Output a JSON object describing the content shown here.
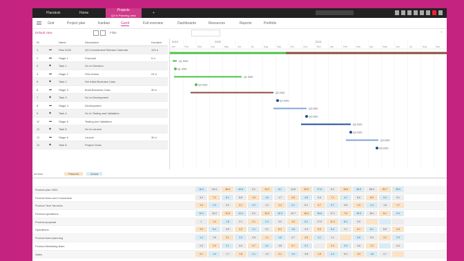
{
  "app": {
    "tabs": [
      "Plandesk",
      "Home",
      "Projects"
    ],
    "tab_subtitle": "Q3 In Planning view",
    "active_tab_index": 2,
    "add_tab_label": "+"
  },
  "ribbon": {
    "items": [
      "Grid",
      "Project plan",
      "Kanban",
      "Gantt",
      "Full overview",
      "Dashboards",
      "Resources",
      "Reports",
      "Portfolio"
    ]
  },
  "toolbar": {
    "view_label": "Default view",
    "filter_label": "Filter",
    "plus_label": "+"
  },
  "gantt": {
    "years": [
      "2019",
      "2020",
      "2021"
    ],
    "months": [
      "Jan",
      "Feb",
      "Mar",
      "Apr",
      "May",
      "Jun",
      "Jul",
      "Aug",
      "Sep",
      "Oct",
      "Nov",
      "Dec",
      "Jan",
      "Feb",
      "Mar",
      "Apr",
      "May",
      "Jun",
      "Jul",
      "Aug",
      "Sep"
    ],
    "bar_labels": [
      "Q1 2020",
      "Q1 2020",
      "Q1 2020",
      "Q2 2020",
      "Q2 2020",
      "Q2 2020",
      "Q3 2020",
      "Q3 2020",
      "Q3 2020",
      "Q3 2020",
      "Q4 2020",
      "Q4 2020"
    ],
    "colors": {
      "green": "#4cc247",
      "blue": "#1f4f95",
      "light_blue": "#7fa6d6",
      "brown": "#8a4b3e"
    }
  },
  "grid": {
    "headers": [
      "ID",
      "Name",
      "Description",
      "Duration"
    ],
    "rows": [
      {
        "id": "1",
        "name": "Plan 2020",
        "description": "Q3 Commitment Release Calendar",
        "duration": "120 d",
        "kind": "summary"
      },
      {
        "id": "2",
        "name": "Stage 1",
        "description": "Proposal",
        "duration": "9 d",
        "kind": "task"
      },
      {
        "id": "3",
        "name": "Task 1",
        "description": "Go to Direction",
        "duration": "",
        "kind": "milestone"
      },
      {
        "id": "4",
        "name": "Stage 2",
        "description": "First review",
        "duration": "24 d",
        "kind": "task"
      },
      {
        "id": "5",
        "name": "Task 2",
        "description": "Set Initial Business Case",
        "duration": "",
        "kind": "milestone"
      },
      {
        "id": "6",
        "name": "Stage 3",
        "description": "Build Business Case",
        "duration": "30 d",
        "kind": "task"
      },
      {
        "id": "7",
        "name": "Task 3",
        "description": "Go to Development",
        "duration": "",
        "kind": "milestone"
      },
      {
        "id": "8",
        "name": "Stage 4",
        "description": "Development",
        "duration": "",
        "kind": "task"
      },
      {
        "id": "9",
        "name": "Task 4",
        "description": "Go to Testing and Validation",
        "duration": "",
        "kind": "milestone"
      },
      {
        "id": "10",
        "name": "Stage 5",
        "description": "Testing and Validation",
        "duration": "",
        "kind": "task"
      },
      {
        "id": "11",
        "name": "Task 5",
        "description": "Go to Launch",
        "duration": "",
        "kind": "milestone"
      },
      {
        "id": "12",
        "name": "Stage 6",
        "description": "Launch",
        "duration": "30 d",
        "kind": "task"
      },
      {
        "id": "13",
        "name": "Task 6",
        "description": "Project Close",
        "duration": "",
        "kind": "milestone"
      }
    ]
  },
  "summary": {
    "label": "All time",
    "legend": [
      "Planned",
      "Actual"
    ]
  },
  "bottom_table": {
    "rows": [
      {
        "label": "Product plan 2020",
        "values": [
          "16.4",
          "23.4",
          "46.6",
          "44.5",
          "5.1",
          "13.2",
          "6.1",
          "14.8",
          "25.9",
          "17.6",
          "5.1",
          "15.6",
          "45.9",
          "68.3",
          "52.7",
          "35.9"
        ]
      },
      {
        "label": "Product team and Consortium",
        "values": [
          "3.4",
          "7.2",
          "8.1",
          "8.8",
          "1.6",
          "1.6",
          "1.7",
          "2.6",
          "4.5",
          "5.4",
          "7.1",
          "4.1",
          "8.6",
          "8.9",
          "9.2",
          "9.1"
        ]
      },
      {
        "label": "Product Tech Services",
        "values": [
          "1.4",
          "2.3",
          "3.4",
          "2.1",
          "2.2",
          "1.2",
          "1.4",
          "2.1",
          "6.1",
          "4.7",
          "3.7",
          "4.6",
          "1.2",
          "1.4",
          "1.6",
          "1.7"
        ]
      },
      {
        "label": "Product operations",
        "values": [
          "10.4",
          "10.2",
          "12.5",
          "12.4",
          "6.2",
          "10.0",
          "10.3",
          "12.7",
          "18.4",
          "16.6",
          "17.1",
          "7.6",
          "16.5",
          "18.1",
          "8.1",
          "9.4"
        ]
      },
      {
        "label": "Product proposal",
        "values": [
          "1",
          "1.4",
          "1.8",
          "2.1",
          "2.1",
          "2.4",
          "3.0",
          "1.9",
          "6.2",
          "17.9",
          "11.4",
          "8.4",
          "9.9",
          "",
          "",
          ""
        ]
      },
      {
        "label": "Operations",
        "values": [
          "3.9",
          "5.4",
          "4.5",
          "4.2",
          "1.1",
          "3.1",
          "6.2",
          "1.8",
          "3.3",
          "9.3",
          "5.4",
          "2.1",
          "6.1",
          "8.1",
          "8.6",
          "4.3"
        ]
      },
      {
        "label": "Product team planning",
        "values": [
          "1.4",
          "1.6",
          "2.1",
          "2.3",
          "4.5",
          "1.1",
          "1.8",
          "4.7",
          "4.5",
          "4.1",
          "1.1",
          "",
          "6.6",
          "5.4",
          "3.1",
          "2.9"
        ]
      },
      {
        "label": "Product Marketing team",
        "values": [
          "2.4",
          "2.3",
          "2.1",
          "3.4",
          "3.7",
          "4.1",
          "4.8",
          "4.7",
          "3.1",
          "",
          "2.4",
          "3.3",
          "4.6",
          "1.2",
          "",
          "3.4"
        ]
      },
      {
        "label": "Sales",
        "values": [
          "0.1",
          "1.4",
          "1.7",
          "1.8",
          "2.1",
          "1.9",
          "2.1",
          "1.9",
          "4.8",
          "1.5",
          "2.4",
          "5.2",
          "4.3",
          "1.8",
          "2.7",
          ""
        ]
      }
    ]
  }
}
